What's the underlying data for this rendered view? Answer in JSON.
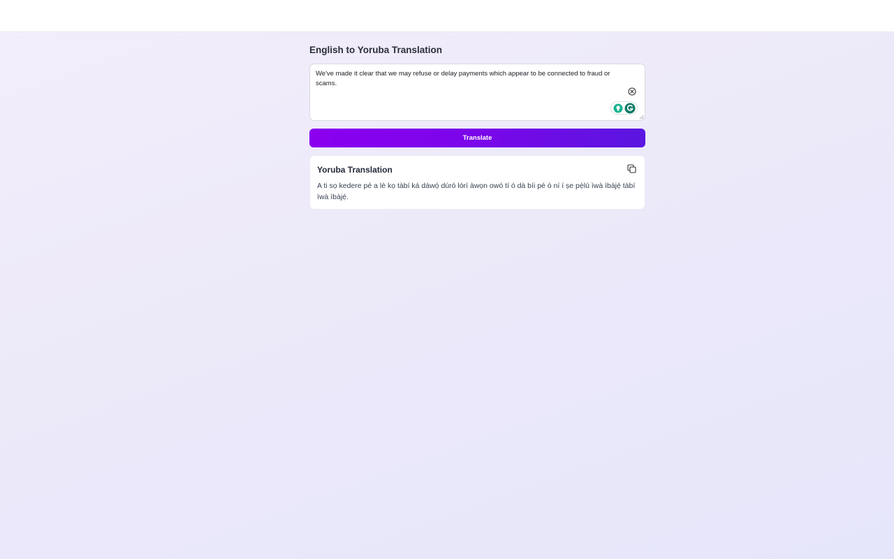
{
  "page": {
    "title": "English to Yoruba Translation"
  },
  "input": {
    "value": "We've made it clear that we may refuse or delay payments which appear to be connected to fraud or scams.",
    "clear_icon": "close-circle-icon",
    "extension_icons": [
      "lightbulb-icon",
      "grammarly-icon"
    ]
  },
  "actions": {
    "translate_label": "Translate"
  },
  "result": {
    "title": "Yoruba Translation",
    "text": "A ti sọ kedere pé a lè kọ tàbí ká dáwọ́ dúró lórí àwọn owó tí ó dà bíi pé ó ní í ṣe pẹ̀lú ìwà ìbàjẹ́ tàbí ìwà ìbàjẹ́.",
    "copy_icon": "copy-icon"
  },
  "colors": {
    "accent_start": "#8b00ef",
    "accent_end": "#5a16e0",
    "grammarly": "#15a68d"
  }
}
